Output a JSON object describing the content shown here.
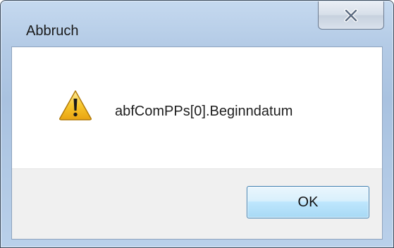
{
  "dialog": {
    "title": "Abbruch",
    "message": "abfComPPs[0].Beginndatum",
    "icon": "warning-icon",
    "close_icon": "close-icon"
  },
  "buttons": {
    "ok_label": "OK"
  },
  "colors": {
    "frame": "#b4cbe6",
    "footer": "#f0f0f0",
    "ok_border": "#3c7fb1",
    "warning_fill": "#f7c72e"
  }
}
